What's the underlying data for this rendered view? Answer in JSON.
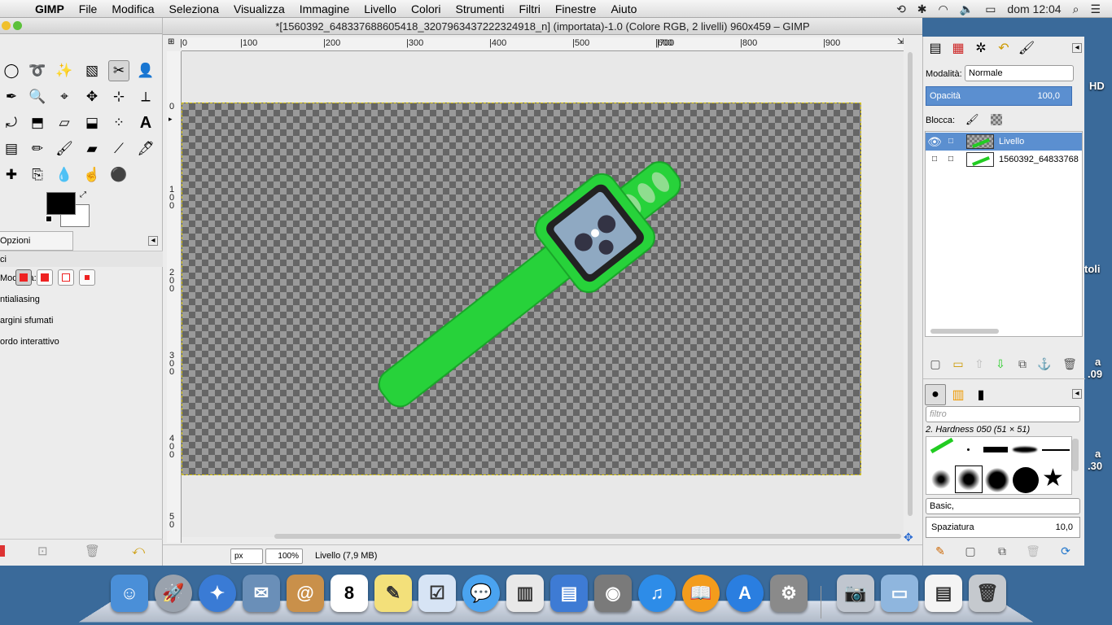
{
  "menubar": {
    "apple_icon": "apple-logo-icon",
    "app_name": "GIMP",
    "items": [
      "File",
      "Modifica",
      "Seleziona",
      "Visualizza",
      "Immagine",
      "Livello",
      "Colori",
      "Strumenti",
      "Filtri",
      "Finestre",
      "Aiuto"
    ],
    "clock": "dom 12:04"
  },
  "desktop_fragments": [
    "HD",
    "toli",
    "a",
    ".09",
    "a",
    ".30"
  ],
  "image_window": {
    "title": "*[1560392_648337688605418_3207963437222324918_n] (importata)-1.0 (Colore RGB, 2 livelli) 960x459 – GIMP",
    "hruler_labels": [
      "|0",
      "|100",
      "|200",
      "|300",
      "|400",
      "|500",
      "|600",
      "|700",
      "|800",
      "|900"
    ],
    "vruler_labels": [
      "0",
      "1\n0\n0",
      "2\n0\n0",
      "3\n0\n0",
      "4\n0\n0",
      "5\n0"
    ],
    "unit": "px",
    "zoom": "100%",
    "status": "Livello (7,9 MB)"
  },
  "toolbox": {
    "options_tab": "Opzioni strumento",
    "mode_label": "Modalità:",
    "mode_cut": "ci",
    "antialiasing": "ntialiasing",
    "feather": "argini sfumati",
    "interactive": "ordo interattivo"
  },
  "layers": {
    "mode_label": "Modalità:",
    "mode_value": "Normale",
    "opacity_label": "Opacità",
    "opacity_value": "100,0",
    "lock_label": "Blocca:",
    "items": [
      {
        "name": "Livello",
        "selected": true
      },
      {
        "name": "1560392_64833768",
        "selected": false
      }
    ]
  },
  "brushes": {
    "filter_placeholder": "filtro",
    "current": "2. Hardness 050 (51 × 51)",
    "preset": "Basic,",
    "spacing_label": "Spaziatura",
    "spacing_value": "10,0"
  },
  "colors": {
    "accent": "#5b8fd0",
    "watch_green": "#27d23a"
  }
}
